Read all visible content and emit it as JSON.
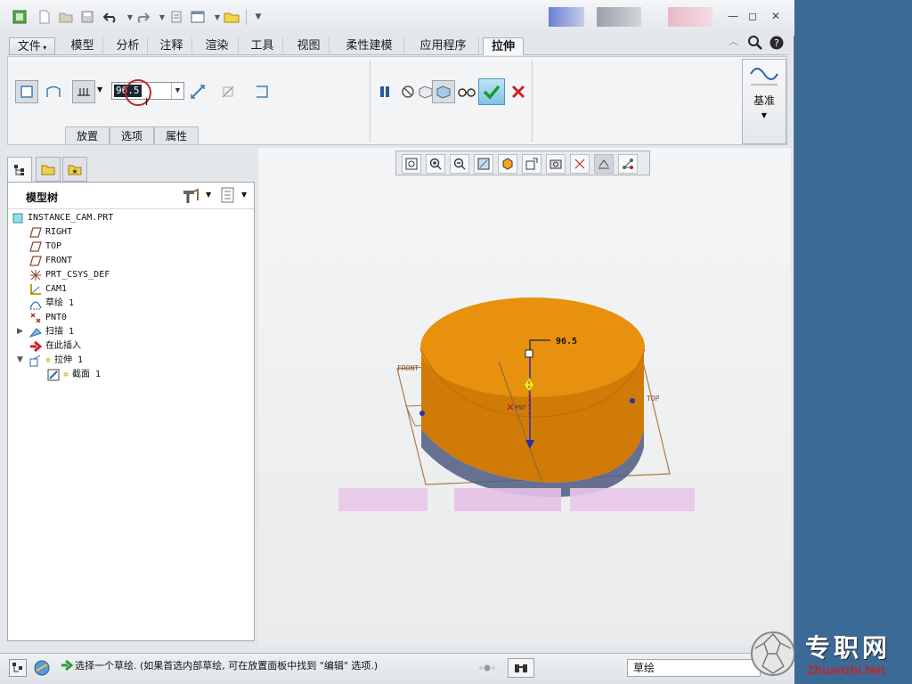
{
  "quick_access": {
    "icons": [
      "app-icon",
      "new-icon",
      "open-icon",
      "save-icon",
      "undo-icon",
      "redo-icon",
      "regenerate-icon",
      "windows-icon",
      "close-window-icon",
      "customize-icon"
    ]
  },
  "window_controls": {
    "minimize": "—",
    "restore": "◻",
    "close": "✕"
  },
  "tabs": [
    "文件",
    "模型",
    "分析",
    "注释",
    "渲染",
    "工具",
    "视图",
    "柔性建模",
    "应用程序",
    "拉伸"
  ],
  "active_tab": "拉伸",
  "ribbon": {
    "depth_value": "96.5",
    "subtabs": [
      "放置",
      "选项",
      "属性"
    ],
    "datum_label": "基准"
  },
  "model_tree": {
    "title": "模型树",
    "items": [
      {
        "label": "INSTANCE_CAM.PRT",
        "icon": "part-icon"
      },
      {
        "label": "RIGHT",
        "icon": "datum-plane-icon"
      },
      {
        "label": "TOP",
        "icon": "datum-plane-icon"
      },
      {
        "label": "FRONT",
        "icon": "datum-plane-icon"
      },
      {
        "label": "PRT_CSYS_DEF",
        "icon": "csys-icon"
      },
      {
        "label": "CAM1",
        "icon": "cam-icon"
      },
      {
        "label": "草绘 1",
        "icon": "sketch-icon"
      },
      {
        "label": "PNT0",
        "icon": "point-icon"
      },
      {
        "label": "扫描 1",
        "icon": "sweep-icon"
      },
      {
        "label": "在此插入",
        "icon": "insert-arrow-icon"
      },
      {
        "label": "拉伸 1",
        "icon": "extrude-icon"
      },
      {
        "label": "截面 1",
        "icon": "section-icon"
      }
    ]
  },
  "viewport": {
    "dimension": "96.5",
    "labels": {
      "front": "FRONT",
      "top": "TOP",
      "pnt": "PNT"
    },
    "colors": {
      "body": "#e8910e",
      "side": "#d07a08",
      "plane": "#b07a45",
      "dim": "#2b2fa8"
    }
  },
  "status": {
    "message": "选择一个草绘. (如果首选内部草绘, 可在放置面板中找到 \"编辑\" 选项.)",
    "filter": "草绘"
  },
  "watermark": {
    "text_cn": "专职网",
    "text_en": "Zhuanzhi.Net"
  }
}
